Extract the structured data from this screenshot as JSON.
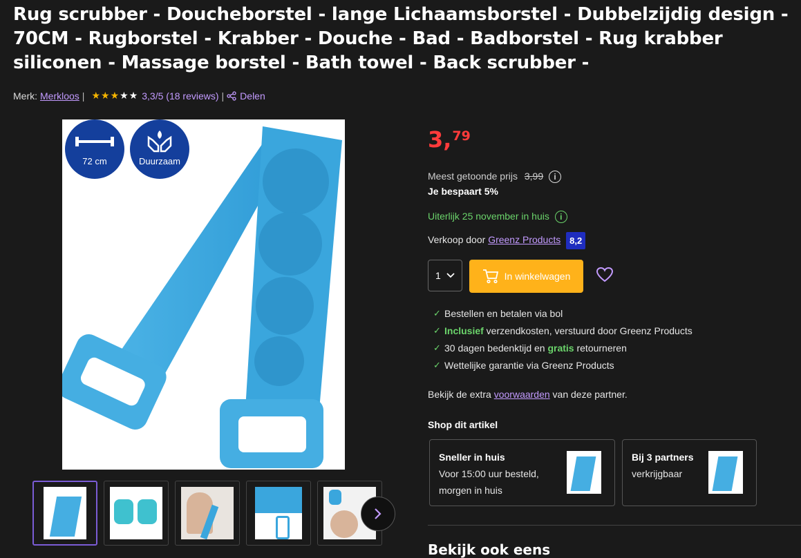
{
  "product": {
    "title": "Rug scrubber - Doucheborstel - lange Lichaamsborstel - Dubbelzijdig design - 70CM - Rugborstel - Krabber - Douche - Bad - Badborstel - Rug krabber siliconen - Massage borstel - Bath towel - Back scrubber -",
    "brand_label": "Merk:",
    "brand": "Merkloos",
    "rating_text": "3,3/5 (18 reviews)",
    "rating_stars": 3.3,
    "share_label": "Delen"
  },
  "image_badges": {
    "length": "72 cm",
    "sustainable": "Duurzaam"
  },
  "price": {
    "euros": "3,",
    "cents": "79",
    "most_shown_label": "Meest getoonde prijs",
    "most_shown_value": "3,99",
    "savings": "Je bespaart 5%"
  },
  "delivery": {
    "text": "Uiterlijk 25 november in huis"
  },
  "seller": {
    "label": "Verkoop door",
    "name": "Greenz Products",
    "score": "8,2"
  },
  "purchase": {
    "quantity": "1",
    "cart_label": "In winkelwagen"
  },
  "usps": {
    "item1": "Bestellen en betalen via bol",
    "item2_bold": "Inclusief",
    "item2_rest": " verzendkosten, verstuurd door Greenz Products",
    "item3_a": "30 dagen bedenktijd en ",
    "item3_bold": "gratis",
    "item3_b": " retourneren",
    "item4": "Wettelijke garantie via Greenz Products"
  },
  "conditions": {
    "prefix": "Bekijk de extra ",
    "link": "voorwaarden",
    "suffix": " van deze partner."
  },
  "shop": {
    "title": "Shop dit artikel",
    "card1_head": "Sneller in huis",
    "card1_line1": "Voor 15:00 uur besteld,",
    "card1_line2": "morgen in huis",
    "card2_head": "Bij 3 partners",
    "card2_line1": "verkrijgbaar"
  },
  "see_also": "Bekijk ook eens",
  "colors": {
    "price": "#ff3b3b",
    "accent_link": "#c39bff",
    "cart_button": "#ffb21a",
    "positive": "#6bd46b",
    "seller_score": "#1f2dbf"
  }
}
